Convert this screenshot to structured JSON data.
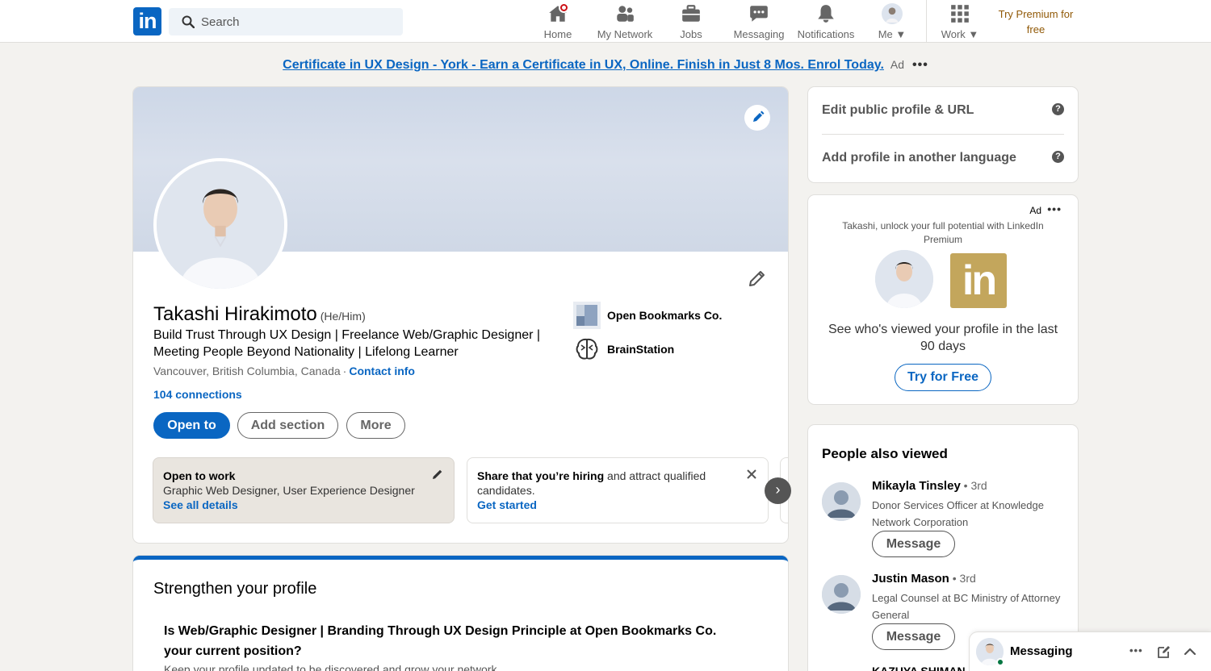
{
  "nav": {
    "logo_text": "in",
    "search_placeholder": "Search",
    "items": [
      {
        "label": "Home",
        "icon": "home-icon"
      },
      {
        "label": "My Network",
        "icon": "network-icon"
      },
      {
        "label": "Jobs",
        "icon": "briefcase-icon"
      },
      {
        "label": "Messaging",
        "icon": "chat-icon"
      },
      {
        "label": "Notifications",
        "icon": "bell-icon"
      },
      {
        "label": "Me",
        "icon": "avatar"
      },
      {
        "label": "Work",
        "icon": "grid-icon"
      }
    ],
    "premium_line1": "Try Premium for",
    "premium_line2": "free"
  },
  "ad_banner": {
    "link_text": "Certificate in UX Design -",
    "rest_text": " York - Earn a Certificate in UX, Online. Finish in Just 8 Mos. Enrol Today.",
    "ad_label": "Ad",
    "more": "•••"
  },
  "profile": {
    "name": "Takashi Hirakimoto",
    "pronouns": "(He/Him)",
    "headline": "Build Trust Through UX Design | Freelance Web/Graphic Designer | Meeting People Beyond Nationality | Lifelong Learner",
    "location": "Vancouver, British Columbia, Canada",
    "separator": "·",
    "contact_info": "Contact info",
    "connections": "104 connections",
    "buttons": {
      "open_to": "Open to",
      "add_section": "Add section",
      "more": "More"
    },
    "companies": [
      {
        "name": "Open Bookmarks Co."
      },
      {
        "name": "BrainStation"
      }
    ],
    "open_to_work": {
      "title": "Open to work",
      "details": "Graphic Web Designer, User Experience Designer",
      "link": "See all details"
    },
    "hiring": {
      "bold": "Share that you’re hiring",
      "text": " and attract qualified candidates.",
      "link": "Get started"
    }
  },
  "strengthen": {
    "title": "Strengthen your profile",
    "question": "Is Web/Graphic Designer | Branding Through UX Design Principle at Open Bookmarks Co. your current position?",
    "subtext": "Keep your profile updated to be discovered and grow your network"
  },
  "sidebar": {
    "edit_public": "Edit public profile & URL",
    "add_language": "Add profile in another language",
    "help_glyph": "?",
    "premium_ad": {
      "ad_label": "Ad",
      "more": "•••",
      "promo": "Takashi, unlock your full potential with LinkedIn Premium",
      "gold_logo": "in",
      "see_who": "See who's viewed your profile in the last 90 days",
      "cta": "Try for Free"
    },
    "people_also_viewed": {
      "title": "People also viewed",
      "people": [
        {
          "name": "Mikayla Tinsley",
          "degree": " • 3rd",
          "role": "Donor Services Officer at Knowledge Network Corporation",
          "button": "Message"
        },
        {
          "name": "Justin Mason",
          "degree": " • 3rd",
          "role": "Legal Counsel at BC Ministry of Attorney General",
          "button": "Message"
        }
      ],
      "partial_name": "KAZUYA SHIMAN"
    }
  },
  "messaging_dock": {
    "title": "Messaging",
    "more": "•••"
  },
  "colors": {
    "brand_blue": "#0a66c2",
    "premium_gold": "#c3a65c",
    "premium_link": "#915907",
    "notification_red": "#cc1016",
    "online_green": "#057642"
  }
}
